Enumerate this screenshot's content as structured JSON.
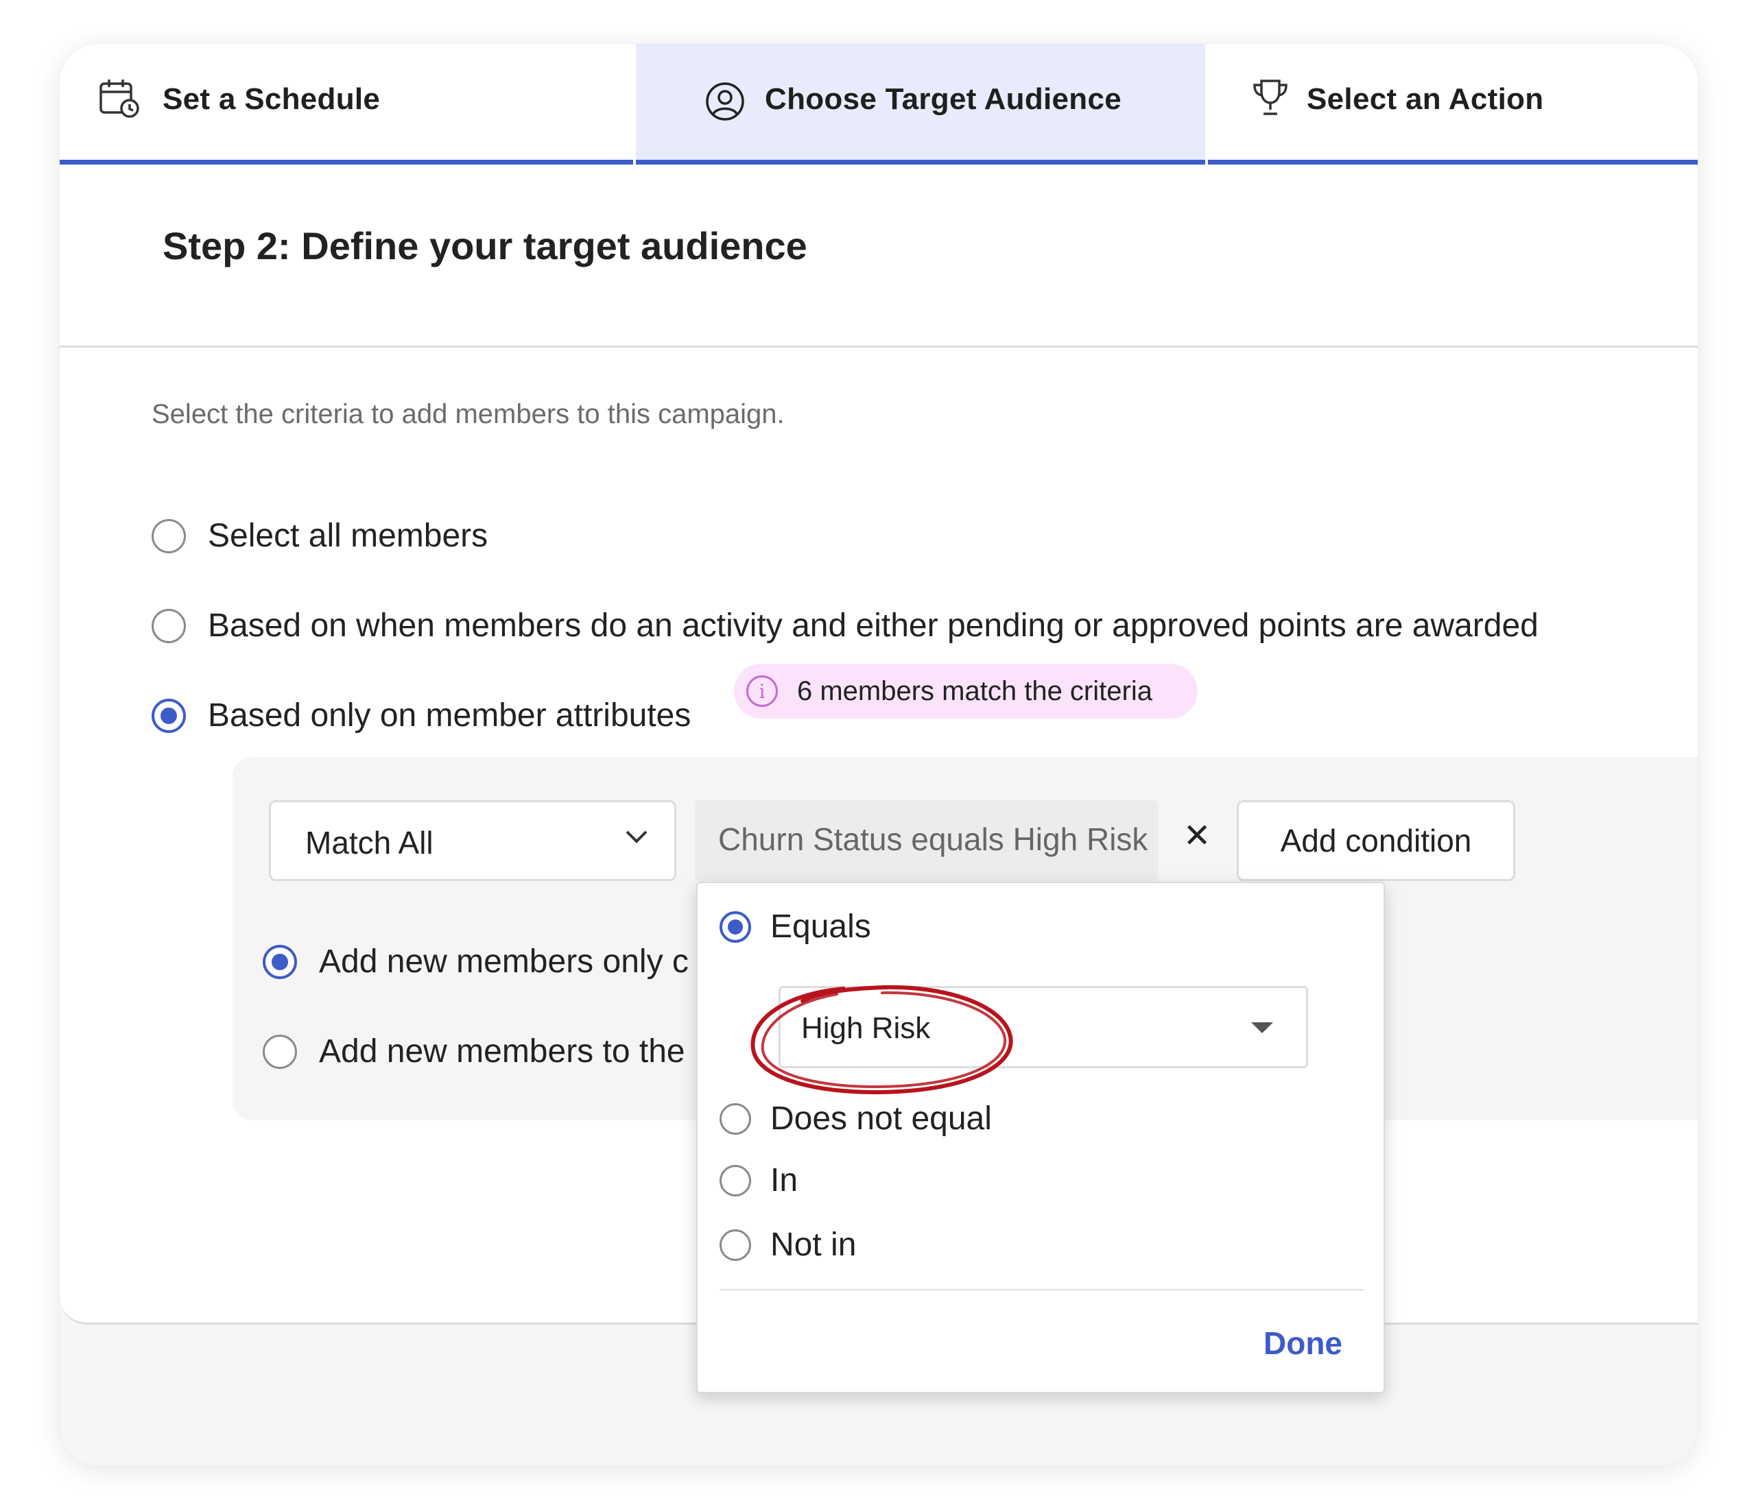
{
  "tabs": [
    {
      "label": "Set a Schedule",
      "icon": "calendar-clock-icon",
      "active": false
    },
    {
      "label": "Choose Target Audience",
      "icon": "user-circle-icon",
      "active": true
    },
    {
      "label": "Select an Action",
      "icon": "trophy-icon",
      "active": false
    }
  ],
  "header": {
    "title": "Step 2: Define your target audience"
  },
  "criteria": {
    "intro": "Select the criteria to add members to this campaign.",
    "options": [
      {
        "label": "Select all members",
        "selected": false
      },
      {
        "label": "Based on when members do an activity and either pending or approved points are awarded",
        "selected": false
      },
      {
        "label": "Based only on member attributes",
        "selected": true
      }
    ],
    "match_badge": {
      "text": "6 members match the criteria",
      "icon": "info-icon"
    }
  },
  "filter": {
    "match_mode": "Match All",
    "condition_chip": "Churn Status equals High Risk",
    "remove_symbol": "✕",
    "add_condition": "Add condition"
  },
  "add_mode": {
    "options": [
      {
        "label": "Add new members only c",
        "selected": true
      },
      {
        "label": "Add new members to the",
        "selected": false
      }
    ]
  },
  "popover": {
    "operators": [
      {
        "label": "Equals",
        "selected": true
      },
      {
        "label": "Does not equal",
        "selected": false
      },
      {
        "label": "In",
        "selected": false
      },
      {
        "label": "Not in",
        "selected": false
      }
    ],
    "value": "High Risk",
    "done": "Done"
  },
  "colors": {
    "accent": "#3d5bc9",
    "badge_bg": "#fbe4fb",
    "annotation": "#b8141c"
  }
}
